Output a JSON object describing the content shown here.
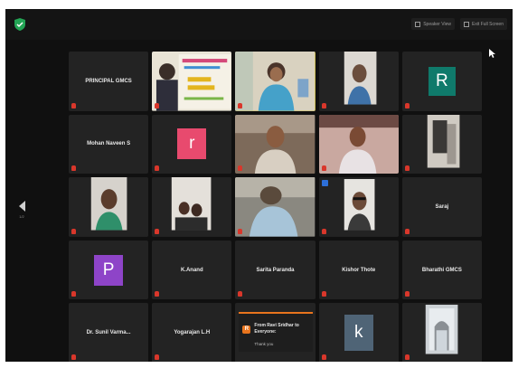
{
  "app": {
    "top_buttons": [
      "Speaker View",
      "Exit Full Screen"
    ]
  },
  "pager": {
    "label": "1/2"
  },
  "grid": {
    "tiles": [
      {
        "kind": "name",
        "label": "PRINCIPAL GMCS",
        "caption": ""
      },
      {
        "kind": "video",
        "label": "",
        "caption": ""
      },
      {
        "kind": "video",
        "label": "",
        "caption": ""
      },
      {
        "kind": "video",
        "label": "",
        "caption": ""
      },
      {
        "kind": "avatar",
        "label": "R",
        "color": "#0f7a6b",
        "caption": ""
      },
      {
        "kind": "name",
        "label": "Mohan Naveen S",
        "caption": ""
      },
      {
        "kind": "avatar",
        "label": "r",
        "color": "#e84a6e",
        "caption": ""
      },
      {
        "kind": "video",
        "label": "",
        "caption": ""
      },
      {
        "kind": "video",
        "label": "",
        "caption": ""
      },
      {
        "kind": "video",
        "label": "",
        "caption": ""
      },
      {
        "kind": "video",
        "label": "",
        "caption": ""
      },
      {
        "kind": "video",
        "label": "",
        "caption": ""
      },
      {
        "kind": "video",
        "label": "",
        "caption": ""
      },
      {
        "kind": "video",
        "label": "",
        "caption": ""
      },
      {
        "kind": "name",
        "label": "Saraj",
        "caption": ""
      },
      {
        "kind": "avatar",
        "label": "P",
        "color": "#8e44c8",
        "caption": ""
      },
      {
        "kind": "name",
        "label": "K.Anand",
        "caption": ""
      },
      {
        "kind": "name",
        "label": "Sarita Paranda",
        "caption": ""
      },
      {
        "kind": "name",
        "label": "Kishor Thote",
        "caption": ""
      },
      {
        "kind": "name",
        "label": "Bharathi GMCS",
        "caption": ""
      },
      {
        "kind": "name",
        "label": "Dr. Sunil Varma...",
        "caption": ""
      },
      {
        "kind": "name",
        "label": "Yogarajan L.H",
        "caption": ""
      },
      {
        "kind": "chat",
        "label": "",
        "caption": ""
      },
      {
        "kind": "avatar",
        "label": "k",
        "color": "#4f6476",
        "caption": ""
      },
      {
        "kind": "video",
        "label": "",
        "caption": ""
      }
    ]
  },
  "chat": {
    "title": "From Ravi Sridhar to Everyone:",
    "message": "Thank you"
  },
  "colors": {
    "active_speaker": "#c9b63a",
    "mic_muted": "#d9372b",
    "chat_accent": "#e8741d"
  }
}
